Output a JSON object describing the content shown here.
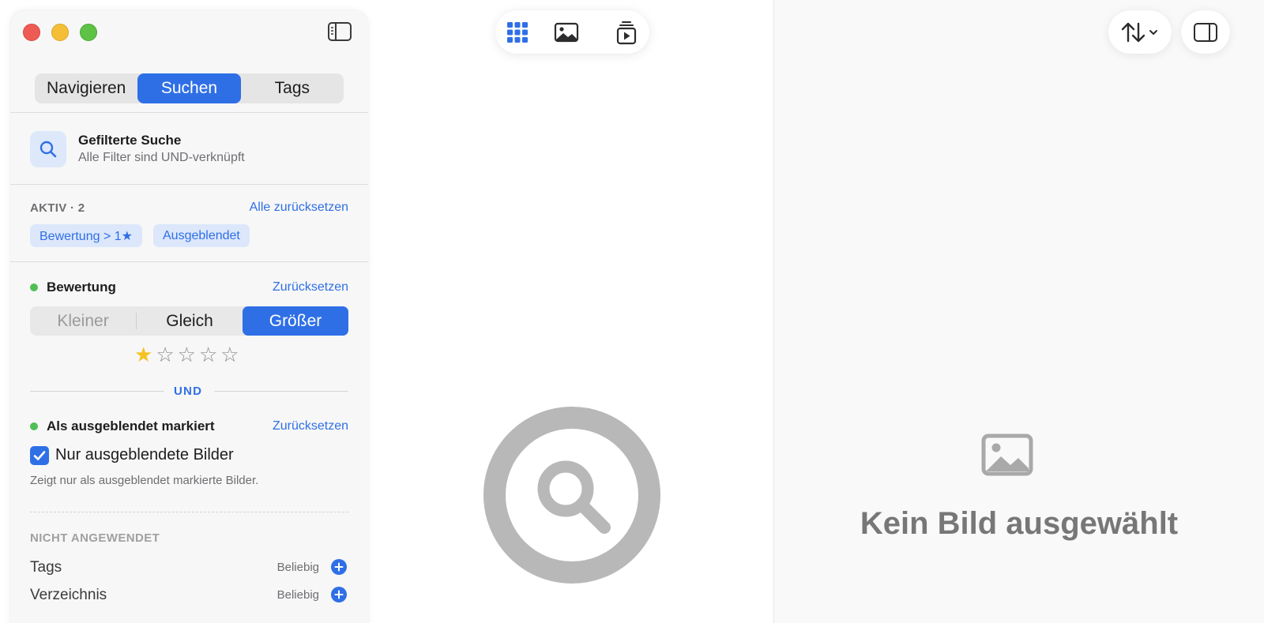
{
  "sidebar": {
    "tabs": [
      {
        "label": "Navigieren",
        "active": false
      },
      {
        "label": "Suchen",
        "active": true
      },
      {
        "label": "Tags",
        "active": false
      }
    ],
    "search_header": {
      "title": "Gefilterte Suche",
      "subtitle": "Alle Filter sind UND-verknüpft"
    },
    "active_filters": {
      "label": "AKTIV · 2",
      "reset_all": "Alle zurücksetzen",
      "chips": [
        "Bewertung > 1★",
        "Ausgeblendet"
      ]
    },
    "rating_filter": {
      "title": "Bewertung",
      "reset": "Zurücksetzen",
      "options": [
        "Kleiner",
        "Gleich",
        "Größer"
      ],
      "selected": "Größer",
      "rating": 1,
      "max_rating": 5
    },
    "conjunction": "UND",
    "hidden_filter": {
      "title": "Als ausgeblendet markiert",
      "reset": "Zurücksetzen",
      "checkbox_label": "Nur ausgeblendete Bilder",
      "checked": true,
      "description": "Zeigt nur als ausgeblendet markierte Bilder."
    },
    "not_applied": {
      "label": "NICHT ANGEWENDET",
      "rows": [
        {
          "label": "Tags",
          "value": "Beliebig"
        },
        {
          "label": "Verzeichnis",
          "value": "Beliebig"
        }
      ]
    }
  },
  "detail": {
    "empty_title": "Kein Bild ausgewählt"
  },
  "colors": {
    "accent": "#2f6fe6",
    "active_dot": "#4fbf56",
    "star": "#f5c222"
  }
}
